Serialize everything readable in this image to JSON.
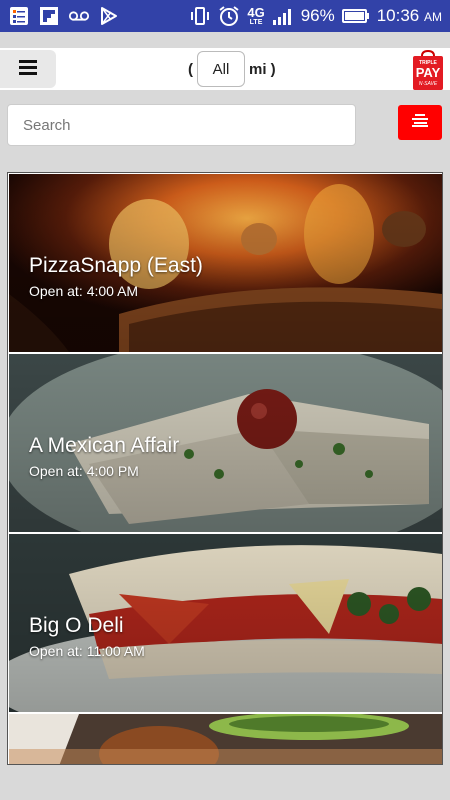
{
  "status_bar": {
    "battery": "96%",
    "time": "10:36",
    "ampm": "AM",
    "network": "4G",
    "network_sub": "LTE",
    "left_icons": [
      "notes-icon",
      "flipboard-icon",
      "voicemail-icon",
      "play-store-icon"
    ],
    "right_icons": [
      "vibrate-icon",
      "alarm-icon",
      "network-icon",
      "signal-icon",
      "battery-icon"
    ]
  },
  "header": {
    "paren_open": "(",
    "distance_value": "All",
    "unit_close": "mi )",
    "logo_lines": [
      "TRIPLE",
      "PAY",
      "N·SAVE"
    ]
  },
  "search": {
    "placeholder": "Search",
    "value": ""
  },
  "listings": [
    {
      "name": "PizzaSnapp (East)",
      "hours_label": "Open at:",
      "hours_value": "4:00 AM"
    },
    {
      "name": "A Mexican Affair",
      "hours_label": "Open at:",
      "hours_value": "4:00 PM"
    },
    {
      "name": "Big O Deli",
      "hours_label": "Open at:",
      "hours_value": "11:00 AM"
    },
    {
      "name": "",
      "hours_label": "",
      "hours_value": ""
    }
  ],
  "colors": {
    "status_bar": "#3242a8",
    "accent": "#ff0000",
    "background": "#d9d9d9"
  }
}
